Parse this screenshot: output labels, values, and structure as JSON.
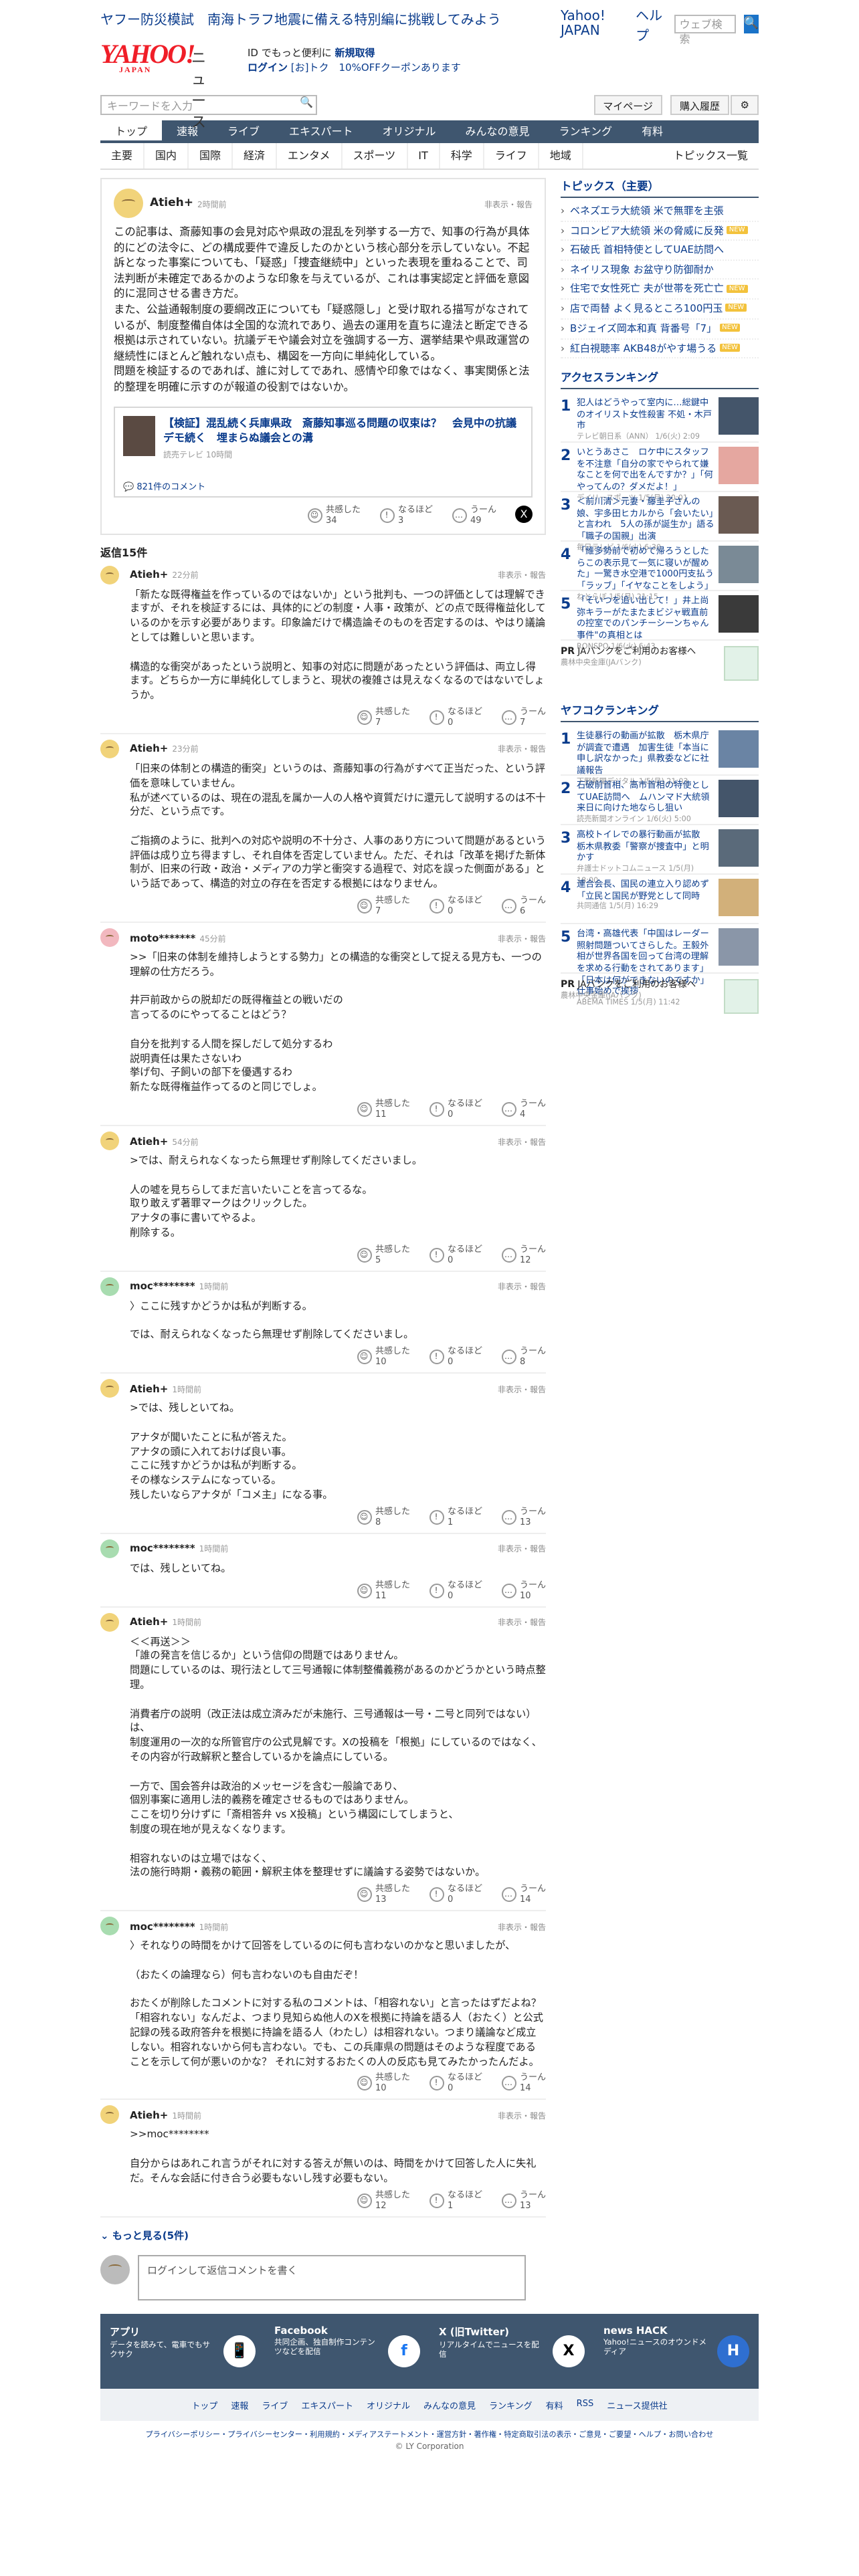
{
  "topbar": {
    "left": "ヤフー防災模試　南海トラフ地震に備える特別編に挑戦してみよう",
    "links": [
      "Yahoo! JAPAN",
      "ヘルプ"
    ],
    "search_placeholder": "ウェブ検索",
    "search_btn": "🔍"
  },
  "header": {
    "logo": "YAHOO!",
    "logo_sub": "JAPAN",
    "news": "ニュース",
    "promo1": "ID でもっと便利に",
    "promo1b": "新規取得",
    "promo2": "ログイン",
    "promo2b": "[お]トク　10%OFFクーポンあります"
  },
  "search": {
    "placeholder": "キーワードを入力",
    "mypage": "マイページ",
    "history": "購入履歴",
    "gear": "⚙"
  },
  "nav": [
    "トップ",
    "速報",
    "ライブ",
    "エキスパート",
    "オリジナル",
    "みんなの意見",
    "ランキング",
    "有料"
  ],
  "subnav": [
    "主要",
    "国内",
    "国際",
    "経済",
    "エンタメ",
    "スポーツ",
    "IT",
    "科学",
    "ライフ",
    "地域"
  ],
  "subnav_right": "トピックス一覧",
  "post": {
    "user": "Atieh+",
    "time": "2時間前",
    "report": "非表示・報告",
    "body": "この記事は、斎藤知事の会見対応や県政の混乱を列挙する一方で、知事の行為が具体的にどの法令に、どの構成要件で違反したのかという核心部分を示していない。不起訴となった事案についても、「疑惑」「捜査継続中」といった表現を重ねることで、司法判断が未確定であるかのような印象を与えているが、これは事実認定と評価を意図的に混同させる書き方だ。\nまた、公益通報制度の要綱改正についても「疑惑隠し」と受け取れる描写がなされているが、制度整備自体は全国的な流れであり、過去の運用を直ちに違法と断定できる根拠は示されていない。抗議デモや議会対立を強調する一方、選挙結果や県政運営の継続性にほとんど触れない点も、構図を一方向に単純化している。\n問題を検証するのであれば、誰に対してであれ、感情や印象ではなく、事実関係と法的整理を明確に示すのが報道の役割ではないか。",
    "related_title": "【検証】混乱続く兵庫県政　斎藤知事巡る問題の収束は？　会見中の抗議デモ続く　埋まらぬ議会との溝",
    "related_src": "読売テレビ 10時間",
    "related_comments": "821件のコメント",
    "reacts": [
      {
        "label": "共感した",
        "count": "34"
      },
      {
        "label": "なるほど",
        "count": "3"
      },
      {
        "label": "うーん",
        "count": "49"
      }
    ]
  },
  "replies_label": "返信15件",
  "replies": [
    {
      "user": "Atieh+",
      "time": "22分前",
      "av": "y",
      "body": "「新たな既得権益を作っているのではないか」という批判も、一つの評価としては理解できますが、それを検証するには、具体的にどの制度・人事・政策が、どの点で既得権益化しているのかを示す必要があります。印象論だけで構造論そのものを否定するのは、やはり議論としては難しいと思います。\n\n構造的な衝突があったという説明と、知事の対応に問題があったという評価は、両立し得ます。どちらか一方に単純化してしまうと、現状の複雑さは見えなくなるのではないでしょうか。",
      "r": [
        "7",
        "0",
        "7"
      ]
    },
    {
      "user": "Atieh+",
      "time": "23分前",
      "av": "y",
      "body": "「旧来の体制との構造的衝突」というのは、斎藤知事の行為がすべて正当だった、という評価を意味していません。\n私が述べているのは、現在の混乱を属か一人の人格や資質だけに還元して説明するのは不十分だ、という点です。\n\nご指摘のように、批判への対応や説明の不十分さ、人事のあり方について問題があるという評価は成り立ち得ますし、それ自体を否定していません。ただ、それは「改革を掲げた新体制が、旧来の行政・政治・メディアの力学と衝突する過程で、対応を誤った側面がある」という話であって、構造的対立の存在を否定する根拠にはなりません。",
      "r": [
        "7",
        "0",
        "6"
      ]
    },
    {
      "user": "moto*******",
      "time": "45分前",
      "av": "p",
      "body": ">>「旧来の体制を維持しようとする勢力」との構造的な衝突として捉える見方も、一つの理解の仕方だろう。\n\n井戸前政からの脱却だの既得権益との戦いだの\n言ってるのにやってることはどう？\n\n自分を批判する人間を探しだして処分するわ\n説明責任は果たさないわ\n挙げ句、子飼いの部下を優遇するわ\n新たな既得権益作ってるのと同じでしょ。",
      "r": [
        "11",
        "0",
        "4"
      ]
    },
    {
      "user": "Atieh+",
      "time": "54分前",
      "av": "y",
      "body": ">では、耐えられなくなったら無理せず削除してくださいまし。\n\n人の嘘を見ちらしてまだ言いたいことを言ってるな。\n取り敢えず著罪マークはクリックした。\nアナタの事に書いてやるよ。\n削除する。",
      "r": [
        "5",
        "0",
        "12"
      ]
    },
    {
      "user": "moc********",
      "time": "1時間前",
      "av": "g",
      "body": "〉ここに残すかどうかは私が判断する。\n\nでは、耐えられなくなったら無理せず削除してくださいまし。",
      "r": [
        "10",
        "0",
        "8"
      ]
    },
    {
      "user": "Atieh+",
      "time": "1時間前",
      "av": "y",
      "body": ">では、残しといてね。\n\nアナタが聞いたことに私が答えた。\nアナタの頭に入れておけば良い事。\nここに残すかどうかは私が判断する。\nその様なシステムになっている。\n残したいならアナタが「コメ主」になる事。",
      "r": [
        "8",
        "1",
        "13"
      ]
    },
    {
      "user": "moc********",
      "time": "1時間前",
      "av": "g",
      "body": "では、残しといてね。",
      "r": [
        "11",
        "0",
        "10"
      ]
    },
    {
      "user": "Atieh+",
      "time": "1時間前",
      "av": "y",
      "body": "＜＜再送＞＞\n「誰の発言を信じるか」という信仰の問題ではありません。\n問題にしているのは、現行法として三号通報に体制整備義務があるのかどうかという時点整理。\n\n消費者庁の説明（改正法は成立済みだが未施行、三号通報は一号・二号と同列ではない）は、\n制度運用の一次的な所管官庁の公式見解です。Xの投稿を「根拠」にしているのではなく、その内容が行政解釈と整合しているかを論点にしている。\n\n一方で、国会答弁は政治的メッセージを含む一般論であり、\n個別事案に適用し法的義務を確定させるものではありません。\nここを切り分けずに「斎相答弁 vs X投稿」という構図にしてしまうと、\n制度の現在地が見えなくなります。\n\n相容れないのは立場ではなく、\n法の施行時期・義務の範囲・解釈主体を整理せずに議論する姿勢ではないか。",
      "r": [
        "13",
        "0",
        "14"
      ]
    },
    {
      "user": "moc********",
      "time": "1時間前",
      "av": "g",
      "body": "〉それなりの時間をかけて回答をしているのに何も言わないのかなと思いましたが、\n\n（おたくの論理なら）何も言わないのも自由だぞ！\n\nおたくが削除したコメントに対する私のコメントは、「相容れない」と言ったはずだよね？「相容れない」なんだよ、つまり見知らぬ他人のXを根拠に持論を語る人（おたく）と公式記録の残る政府答弁を根拠に持論を語る人（わたし）は相容れない。つまり議論など成立しない。相容れないから何も言わない。でも、この兵庫県の問題はそのような程度であることを示して何が悪いのかな？ それに対するおたくの人の反応も見てみたかったんだよ。",
      "r": [
        "10",
        "0",
        "14"
      ]
    },
    {
      "user": "Atieh+",
      "time": "1時間前",
      "av": "y",
      "body": ">>moc********\n\n自分からはあれこれ言うがそれに対する答えが無いのは、時間をかけて回答した人に失礼だ。そんな会話に付き合う必要もないし残す必要もない。",
      "r": [
        "12",
        "1",
        "13"
      ]
    }
  ],
  "more_label": "もっと見る(5件)",
  "reply_placeholder": "ログインして返信コメントを書く",
  "topics_head": "トピックス（主要）",
  "topics": [
    {
      "t": "ベネズエラ大統領 米で無罪を主張",
      "b": ""
    },
    {
      "t": "コロンビア大統領 米の脅威に反発",
      "b": "NEW"
    },
    {
      "t": "石破氏 首相特使としてUAE訪問へ",
      "b": ""
    },
    {
      "t": "ネイリス現象 お盆守り防御耐か",
      "b": ""
    },
    {
      "t": "住宅で女性死亡 夫が世帯を死亡亡",
      "b": "NEW"
    },
    {
      "t": "店で両替 よく見るところ100円玉",
      "b": "NEW"
    },
    {
      "t": "Bジェイズ岡本和真 背番号「7」",
      "b": "NEW"
    },
    {
      "t": "紅白視聴率 AKB48がやす場うる",
      "b": "NEW"
    }
  ],
  "ranking_head": "アクセスランキング",
  "ranking": [
    {
      "n": "1",
      "t": "犯人はどうやって室内に…総鍵中のオイリスト女性殺害 不処・木戸市",
      "s": "テレビ朝日系（ANN） 1/6(火) 2:09",
      "c": "#44556a"
    },
    {
      "n": "2",
      "t": "いとうあさこ　ロケ中にスタッフを不注意「自分の家でやられて嫌なことを何で出をんですか？」「何やってんの？ダメだよ！」",
      "s": "デイリースポーツ 1/5(月) 20:01",
      "c": "#e5a7a0"
    },
    {
      "n": "3",
      "t": "＜前川清＞元妻・藤圭子さんの娘、宇多田ヒカルから「会いたい」と言われ　5人の孫が誕生か」語る「職子の国親」出演",
      "s": "毎日テレビ 1/6(火) 6:30",
      "c": "#6a5a52"
    },
    {
      "n": "4",
      "t": "「維多勢前で初めて帰ろうとしたらこの表示見て一気に寝いが醒めた」一驚き水空港で1000円支払う「ラッブ」「イヤなことをしよう」",
      "s": "ねとらぼ 1/5(月) 21:15",
      "c": "#7a8a96"
    },
    {
      "n": "5",
      "t": "「そいつを追い出して！」井上尚弥キラーがたまたまビジャ戦直前の控室でのパンチーシーンちゃん事件\"の真相とは",
      "s": "RONSPO 1/6(火) 6:43",
      "c": "#3a3a3a"
    }
  ],
  "pr1": {
    "t": "JAバンクをご利用のお客様へ",
    "s": "農林中央金庫(JAバンク)",
    "label": "PR"
  },
  "yahooranking_head": "ヤフコクランキング",
  "ranking2": [
    {
      "n": "1",
      "t": "生徒暴行の動画が拡散　栃木県庁が調査で遭遇　加害生徒「本当に申し訳なかった」県教委などに社議報告",
      "s": "下野新聞デジタル 1/5(月) 21:03",
      "c": "#6a84a4"
    },
    {
      "n": "2",
      "t": "石破前首相、高市首相の特使としてUAE訪問へ　ムハンマド大統領来日に向けた地ならし狙い",
      "s": "読売新聞オンライン 1/6(火) 5:00",
      "c": "#44556a"
    },
    {
      "n": "3",
      "t": "高校トイレでの暴行動画が拡散　栃木県教委「警察が捜査中」と明かす",
      "s": "弁護士ドットコムニュース 1/5(月) 18:00",
      "c": "#5a6a7a"
    },
    {
      "n": "4",
      "t": "連合会長、国民の連立入り認めず「立民と国民が野党として同時",
      "s": "共同通信 1/5(月) 16:29",
      "c": "#d2b07a"
    },
    {
      "n": "5",
      "t": "台湾・高雄代表「中国はレーダー照射問題ついてさらした。王毅外相が世界各国を回って台湾の理解を求める行動をされてあります」「日本は何ができないのですか」仕事始めで挨拶",
      "s": "ABEMA TIMES 1/5(月) 11:42",
      "c": "#8a96a8"
    }
  ],
  "pr2": {
    "t": "JAバンクをご利用のお客様へ",
    "s": "農林中央金庫(JAバンク)",
    "label": "PR"
  },
  "apps": [
    {
      "t": "アプリ",
      "s": "データを読みて、電車でもサクサク",
      "i": "📱"
    },
    {
      "t": "Facebook",
      "s": "共同企画、独自制作コンテンツなどを配信",
      "i": "f"
    },
    {
      "t": "X (旧Twitter)",
      "s": "リアルタイムでニュースを配信",
      "i": "X"
    },
    {
      "t": "news HACK",
      "s": "Yahoo!ニュースのオウンドメディア",
      "i": "H"
    }
  ],
  "footer_nav": [
    "トップ",
    "速報",
    "ライブ",
    "エキスパート",
    "オリジナル",
    "みんなの意見",
    "ランキング",
    "有料",
    "RSS",
    "ニュース提供社"
  ],
  "footer_links": "プライバシーポリシー・プライバシーセンター・利用規約・メディアステートメント・運営方針・著作権・特定商取引法の表示・ご意見・ご要望・ヘルプ・お問い合わせ",
  "copyright": "© LY Corporation"
}
